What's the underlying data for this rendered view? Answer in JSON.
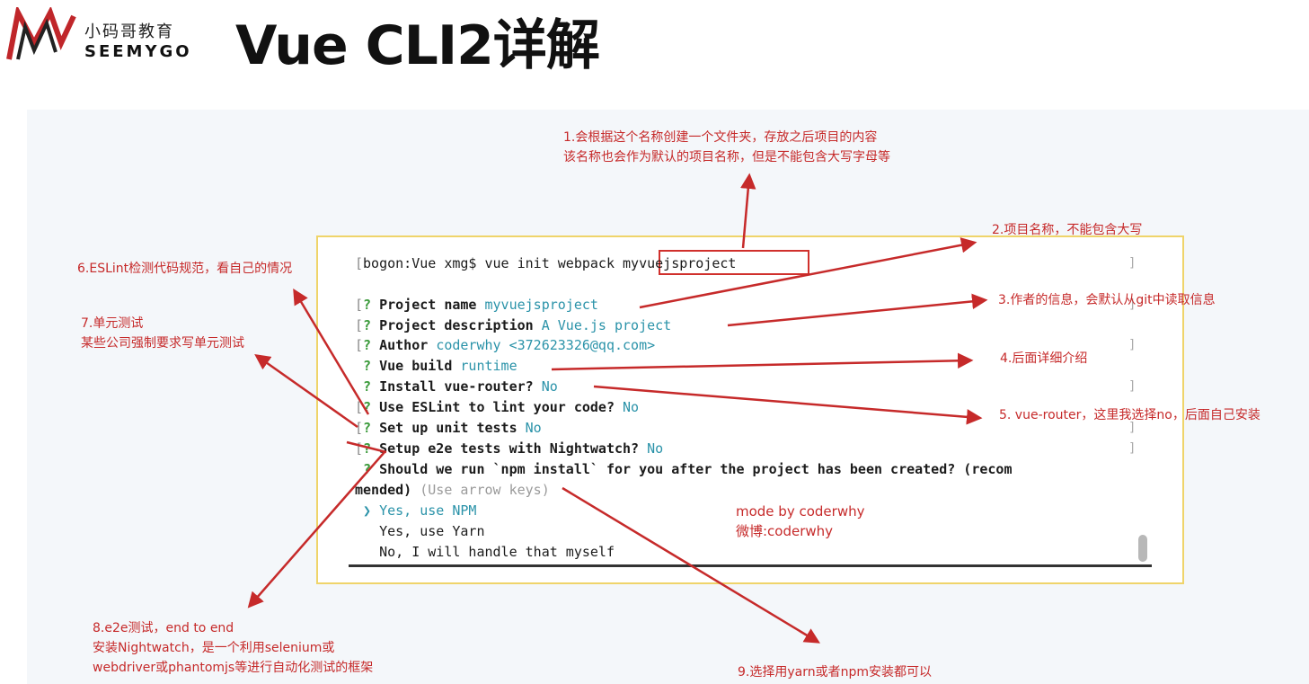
{
  "brand": {
    "cn": "小码哥教育",
    "en": "SEEMYGO",
    "logo_color": "#c0262a"
  },
  "title": "Vue CLI2详解",
  "terminal": {
    "command_prefix": "bogon:Vue xmg$ vue init webpack ",
    "project_arg": "myvuejsproject",
    "lines": [
      {
        "label": "Project name",
        "value": "myvuejsproject"
      },
      {
        "label": "Project description",
        "value": "A Vue.js project"
      },
      {
        "label": "Author",
        "value": "coderwhy <372623326@qq.com>"
      },
      {
        "label": "Vue build",
        "value": "runtime"
      },
      {
        "label": "Install vue-router?",
        "value": "No"
      },
      {
        "label": "Use ESLint to lint your code?",
        "value": "No"
      },
      {
        "label": "Set up unit tests",
        "value": "No"
      },
      {
        "label": "Setup e2e tests with Nightwatch?",
        "value": "No"
      }
    ],
    "question_line1": "Should we run `npm install` for you after the project has been created? (recom",
    "question_line2": "mended)",
    "question_hint": "(Use arrow keys)",
    "options": [
      {
        "text": "Yes, use NPM",
        "selected": true
      },
      {
        "text": "Yes, use Yarn",
        "selected": false
      },
      {
        "text": "No, I will handle that myself",
        "selected": false
      }
    ],
    "selector_glyph": "❯",
    "prompt_glyph": "?",
    "open_bracket": "[",
    "close_bracket": "]"
  },
  "annotations": {
    "a1_line1": "1.会根据这个名称创建一个文件夹，存放之后项目的内容",
    "a1_line2": "该名称也会作为默认的项目名称，但是不能包含大写字母等",
    "a2": "2.项目名称，不能包含大写",
    "a3": "3.作者的信息，会默认从git中读取信息",
    "a4": "4.后面详细介绍",
    "a5": "5. vue-router，这里我选择no，后面自己安装",
    "a6": "6.ESLint检测代码规范，看自己的情况",
    "a7_line1": "7.单元测试",
    "a7_line2": "某些公司强制要求写单元测试",
    "a8_line1": "8.e2e测试，end to end",
    "a8_line2": "安装Nightwatch，是一个利用selenium或",
    "a8_line3": "webdriver或phantomjs等进行自动化测试的框架",
    "a9": "9.选择用yarn或者npm安装都可以"
  },
  "mode_note": {
    "line1": "mode by coderwhy",
    "line2": "微博:coderwhy"
  },
  "colors": {
    "annotation_red": "#c62a2a",
    "terminal_value_cyan": "#2b93a9",
    "prompt_green": "#3a9a3a",
    "terminal_border": "#efd46a"
  }
}
